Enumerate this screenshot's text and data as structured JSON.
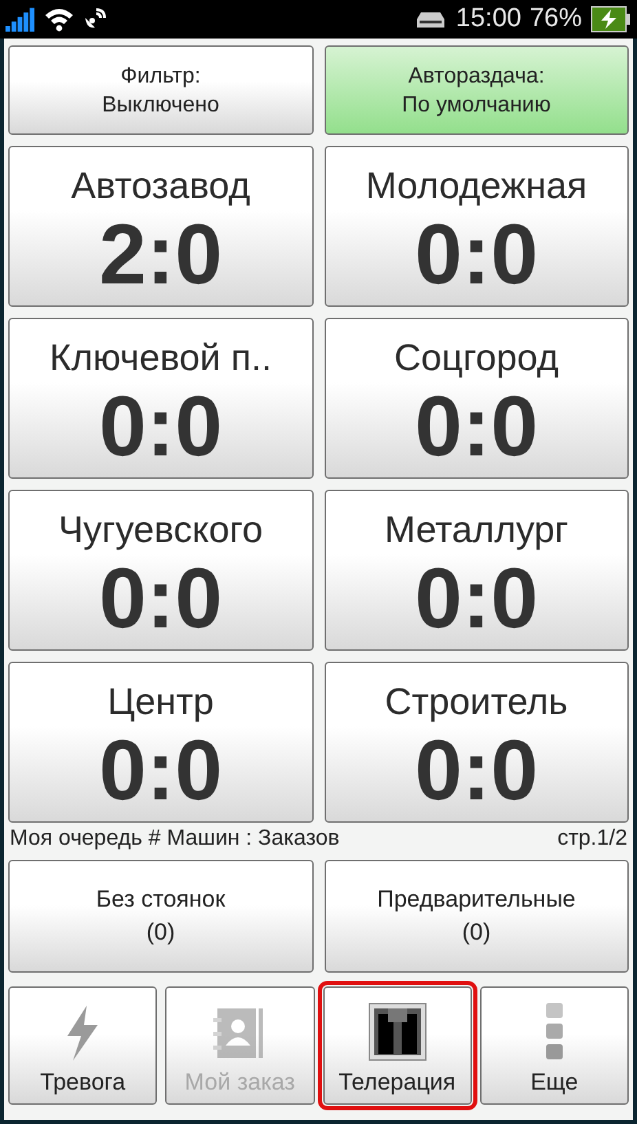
{
  "status_bar": {
    "time": "15:00",
    "battery": "76%",
    "battery_charging": true
  },
  "top_buttons": [
    {
      "line1": "Фильтр:",
      "line2": "Выключено",
      "on": false
    },
    {
      "line1": "Автораздача:",
      "line2": "По умолчанию",
      "on": true
    }
  ],
  "zones": [
    {
      "name": "Автозавод",
      "score": "2:0"
    },
    {
      "name": "Молодежная",
      "score": "0:0"
    },
    {
      "name": "Ключевой п..",
      "score": "0:0"
    },
    {
      "name": "Соцгород",
      "score": "0:0"
    },
    {
      "name": "Чугуевского",
      "score": "0:0"
    },
    {
      "name": "Металлург",
      "score": "0:0"
    },
    {
      "name": "Центр",
      "score": "0:0"
    },
    {
      "name": "Строитель",
      "score": "0:0"
    }
  ],
  "queue": {
    "label": "Моя очередь # Машин : Заказов",
    "page": "стр.1/2"
  },
  "queue_buttons": [
    {
      "label": "Без стоянок",
      "count": "(0)"
    },
    {
      "label": "Предварительные",
      "count": "(0)"
    }
  ],
  "nav": [
    {
      "kind": "bolt",
      "label": "Тревога",
      "disabled": false,
      "selected": false
    },
    {
      "kind": "contacts",
      "label": "Мой заказ",
      "disabled": true,
      "selected": false
    },
    {
      "kind": "radio",
      "label": "Телерация",
      "disabled": false,
      "selected": true
    },
    {
      "kind": "more",
      "label": "Еще",
      "disabled": false,
      "selected": false
    }
  ]
}
